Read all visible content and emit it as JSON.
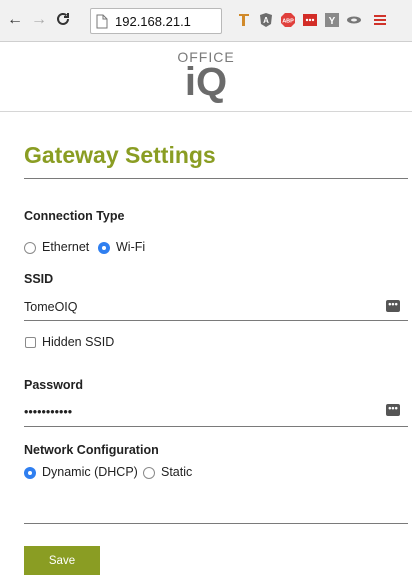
{
  "browser": {
    "url": "192.168.21.1",
    "back_icon": "arrow-left",
    "forward_icon": "arrow-right",
    "reload_icon": "reload",
    "extensions": [
      {
        "name": "tag-extension-icon",
        "color": "#d18a2a"
      },
      {
        "name": "angular-extension-icon",
        "color": "#6d6d6d"
      },
      {
        "name": "adblock-plus-icon",
        "label": "ABP",
        "color": "#e0403c"
      },
      {
        "name": "lastpass-icon",
        "label": "•••",
        "color": "#d32d27"
      },
      {
        "name": "y-extension-icon",
        "label": "Y",
        "color": "#8a8a8a"
      },
      {
        "name": "cast-icon",
        "color": "#777777"
      },
      {
        "name": "menu-icon",
        "color": "#d0332a"
      }
    ]
  },
  "logo": {
    "office": "OFFICE",
    "iq": "iQ"
  },
  "page": {
    "title": "Gateway Settings",
    "accent_color": "#8a9d23"
  },
  "connection": {
    "label": "Connection Type",
    "options": [
      "Ethernet",
      "Wi-Fi"
    ],
    "selected": "Wi-Fi"
  },
  "ssid": {
    "label": "SSID",
    "value": "TomeOIQ"
  },
  "hidden_ssid": {
    "label": "Hidden SSID",
    "checked": false
  },
  "password": {
    "label": "Password",
    "value": "•••••••••••"
  },
  "network": {
    "label": "Network Configuration",
    "options": [
      "Dynamic (DHCP)",
      "Static"
    ],
    "selected": "Dynamic (DHCP)"
  },
  "actions": {
    "save_label": "Save"
  }
}
